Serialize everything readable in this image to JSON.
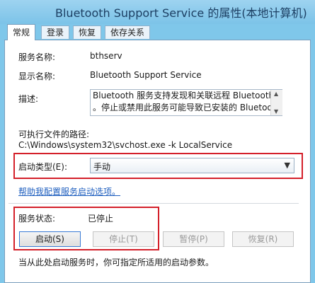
{
  "window": {
    "title": "Bluetooth Support Service 的属性(本地计算机)"
  },
  "tabs": [
    "常规",
    "登录",
    "恢复",
    "依存关系"
  ],
  "general": {
    "service_name_label": "服务名称:",
    "service_name": "bthserv",
    "display_name_label": "显示名称:",
    "display_name": "Bluetooth Support Service",
    "description_label": "描述:",
    "description_line1": "Bluetooth 服务支持发现和关联远程 Bluetooth 设备",
    "description_line2": "。停止或禁用此服务可能导致已安装的 Bluetooth 设",
    "exe_path_label": "可执行文件的路径:",
    "exe_path": "C:\\Windows\\system32\\svchost.exe -k LocalService",
    "startup_type_label": "启动类型(E):",
    "startup_type_value": "手动",
    "help_link": "帮助我配置服务启动选项。",
    "status_label": "服务状态:",
    "status_value": "已停止",
    "buttons": {
      "start": "启动(S)",
      "stop": "停止(T)",
      "pause": "暂停(P)",
      "resume": "恢复(R)"
    },
    "hint": "当从此处启动服务时，你可指定所适用的启动参数。"
  },
  "colors": {
    "title_bar": "#8ecdee",
    "highlight_red": "#d4202a",
    "link": "#1f5fbf"
  }
}
